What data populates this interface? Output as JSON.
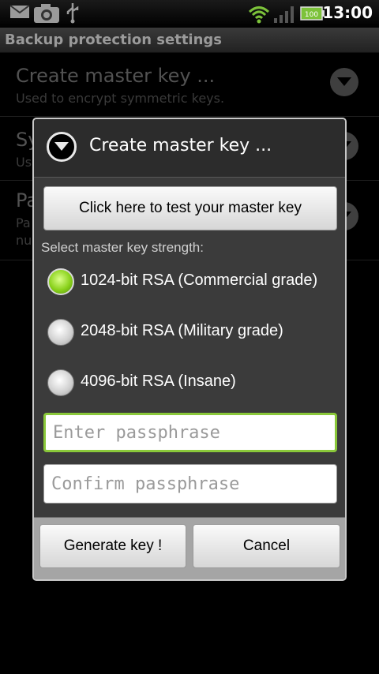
{
  "status_bar": {
    "time": "13:00",
    "battery": "100",
    "icons": [
      "gmail-icon",
      "camera-icon",
      "usb-icon",
      "wifi-icon",
      "signal-icon",
      "battery-icon"
    ]
  },
  "title_bar": {
    "title": "Backup protection settings"
  },
  "preferences": [
    {
      "title": "Create master key ...",
      "summary": "Used to encrypt symmetric keys."
    },
    {
      "title": "Sy",
      "summary": "Us"
    },
    {
      "title": "Pa",
      "summary": "Pa",
      "summary2": "nu"
    }
  ],
  "dialog": {
    "title": "Create master key ...",
    "test_button": "Click here to test your master key",
    "strength_label": "Select master key strength:",
    "options": [
      {
        "label": "1024-bit RSA (Commercial grade)",
        "selected": true
      },
      {
        "label": "2048-bit RSA (Military grade)",
        "selected": false
      },
      {
        "label": "4096-bit RSA (Insane)",
        "selected": false
      }
    ],
    "passphrase_placeholder": "Enter passphrase",
    "confirm_placeholder": "Confirm passphrase",
    "generate_button": "Generate key !",
    "cancel_button": "Cancel"
  },
  "colors": {
    "accent_green": "#8ac83a",
    "dialog_bg": "#3b3b3b",
    "footer_bg": "#a5a5a5"
  }
}
